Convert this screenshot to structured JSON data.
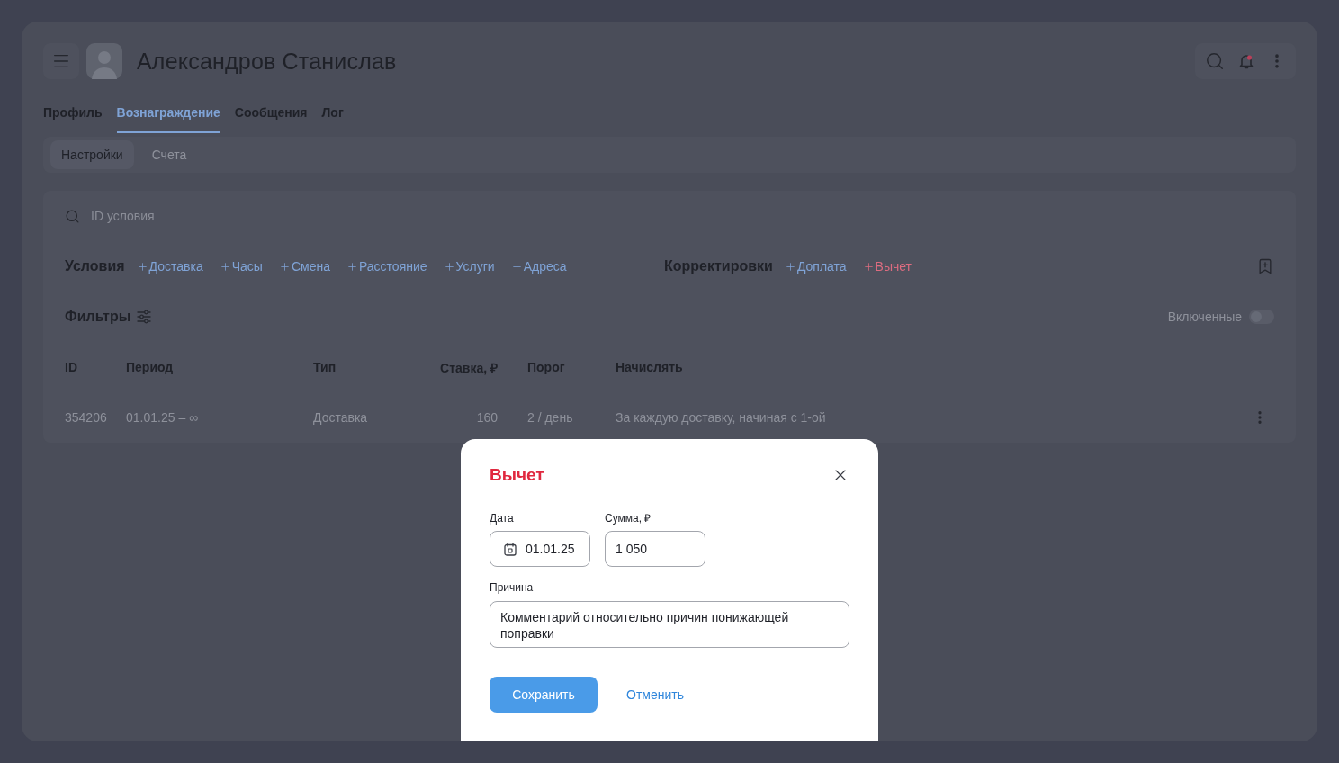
{
  "header": {
    "title": "Александров Станислав"
  },
  "tabs": [
    {
      "label": "Профиль",
      "selected": false
    },
    {
      "label": "Вознаграждение",
      "selected": true
    },
    {
      "label": "Сообщения",
      "selected": false
    },
    {
      "label": "Лог",
      "selected": false
    }
  ],
  "subtabs": [
    {
      "label": "Настройки",
      "selected": true
    },
    {
      "label": "Счета",
      "selected": false
    }
  ],
  "search": {
    "placeholder": "ID условия"
  },
  "conditions": {
    "title": "Условия",
    "actions": [
      "Доставка",
      "Часы",
      "Смена",
      "Расстояние",
      "Услуги",
      "Адреса"
    ]
  },
  "adjustments": {
    "title": "Корректировки",
    "actions": [
      {
        "label": "Доплата",
        "color": "#7fa3d6"
      },
      {
        "label": "Вычет",
        "color": "#dc6c80"
      }
    ]
  },
  "filters": {
    "title": "Фильтры",
    "toggle": {
      "label": "Включенные",
      "on": false
    }
  },
  "table": {
    "columns": [
      "ID",
      "Период",
      "Тип",
      "Ставка, ₽",
      "Порог",
      "Начислять"
    ],
    "rows": [
      {
        "cells": [
          "354206",
          "01.01.25 – ∞",
          "Доставка",
          "160",
          "2 / день",
          "За каждую доставку, начиная с 1-ой"
        ]
      }
    ]
  },
  "dialog": {
    "title": "Вычет",
    "fields": [
      {
        "kind": "date",
        "label": "Дата",
        "value": "01.01.25"
      },
      {
        "kind": "number",
        "label": "Сумма, ₽",
        "value": "1 050"
      }
    ],
    "reason": {
      "label": "Причина",
      "value": "Комментарий относительно причин понижающей поправки"
    },
    "buttons": [
      {
        "kind": "primary",
        "label": "Сохранить"
      },
      {
        "kind": "link",
        "label": "Отменить"
      }
    ]
  }
}
